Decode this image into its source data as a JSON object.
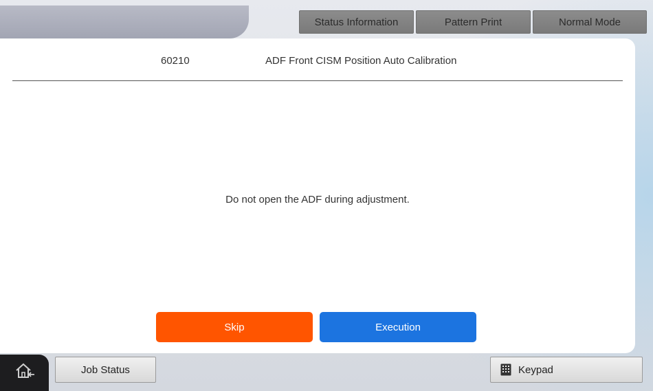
{
  "top_tabs": {
    "status_information": "Status Information",
    "pattern_print": "Pattern Print",
    "normal_mode": "Normal Mode"
  },
  "header": {
    "code": "60210",
    "title": "ADF Front CISM Position Auto Calibration"
  },
  "main": {
    "message": "Do not open the ADF during adjustment."
  },
  "buttons": {
    "skip": "Skip",
    "execution": "Execution"
  },
  "bottom_bar": {
    "home_icon": "home-icon",
    "job_status": "Job Status",
    "keypad": "Keypad",
    "keypad_icon": "keypad-icon"
  },
  "colors": {
    "skip": "#ff5500",
    "execution": "#1c74e0"
  }
}
